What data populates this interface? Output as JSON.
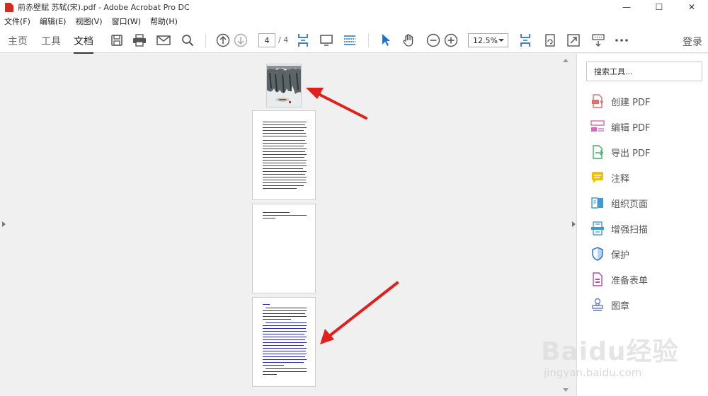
{
  "window": {
    "title": "前赤壁赋 苏轼(宋).pdf - Adobe Acrobat Pro DC",
    "minimize": "—",
    "maximize": "☐",
    "close": "✕"
  },
  "menu": [
    "文件(F)",
    "编辑(E)",
    "视图(V)",
    "窗口(W)",
    "帮助(H)"
  ],
  "nav_tabs": [
    {
      "label": "主页",
      "active": false
    },
    {
      "label": "工具",
      "active": false
    },
    {
      "label": "文档",
      "active": true
    }
  ],
  "page_nav": {
    "current": "4",
    "total": "/ 4"
  },
  "zoom": {
    "value": "12.5%"
  },
  "signin": "登录",
  "tools_search": {
    "placeholder": "搜索工具..."
  },
  "tools": [
    {
      "label": "创建 PDF",
      "icon": "create-pdf-icon",
      "color": "#e06e6e"
    },
    {
      "label": "编辑 PDF",
      "icon": "edit-pdf-icon",
      "color": "#d966b6"
    },
    {
      "label": "导出 PDF",
      "icon": "export-pdf-icon",
      "color": "#3fae6a"
    },
    {
      "label": "注释",
      "icon": "comment-icon",
      "color": "#f2c200"
    },
    {
      "label": "组织页面",
      "icon": "organize-pages-icon",
      "color": "#3a9bd6"
    },
    {
      "label": "增强扫描",
      "icon": "enhance-scan-icon",
      "color": "#3a9bd6"
    },
    {
      "label": "保护",
      "icon": "protect-icon",
      "color": "#3a78d6"
    },
    {
      "label": "准备表单",
      "icon": "prepare-form-icon",
      "color": "#b44ea0"
    },
    {
      "label": "图章",
      "icon": "stamp-icon",
      "color": "#6b7bc4"
    }
  ],
  "watermark": {
    "brand": "Baidu经验",
    "url": "jingyan.baidu.com"
  },
  "colors": {
    "accent": "#1473e6",
    "arrow": "#e0201c"
  }
}
